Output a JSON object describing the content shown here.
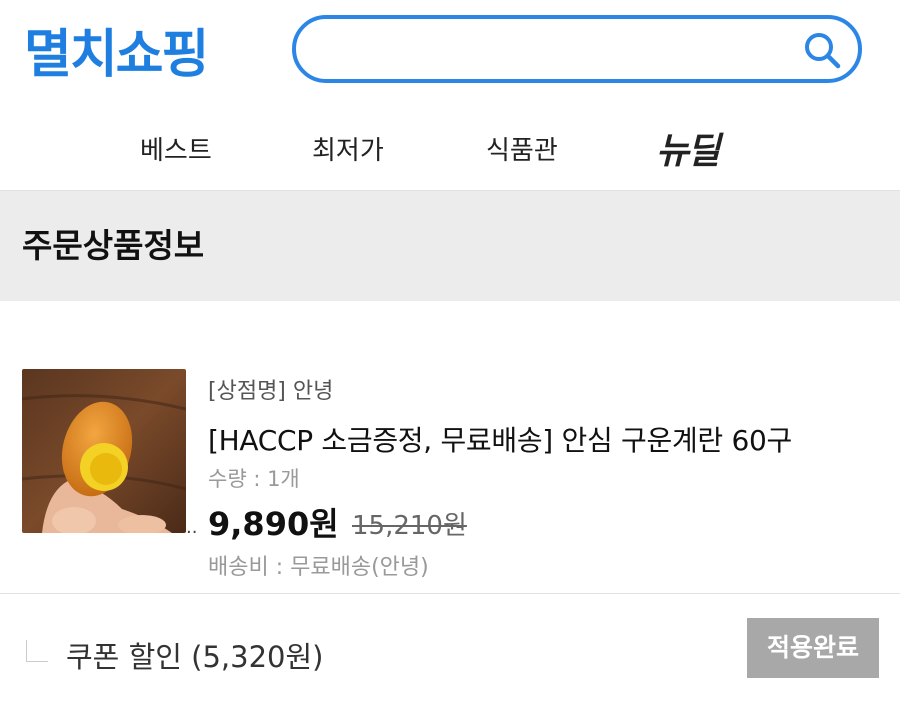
{
  "header": {
    "logo_text": "멸치쇼핑",
    "search_placeholder": "",
    "search_value": ""
  },
  "nav": {
    "items": [
      "베스트",
      "최저가",
      "식품관",
      "뉴딜"
    ]
  },
  "section": {
    "title": "주문상품정보"
  },
  "product": {
    "store": "[상점명] 안녕",
    "name": "[HACCP 소금증정, 무료배송] 안심 구운계란 60구",
    "quantity": "수량 : 1개",
    "price": "9,890원",
    "original_price": "15,210원",
    "shipping": "배송비 : 무료배송(안녕)",
    "ellipsis": "..",
    "image_icon": "egg-product-photo"
  },
  "coupon": {
    "label": "쿠폰 할인 (5,320원)",
    "button_label": "적용완료"
  },
  "colors": {
    "brand_blue": "#1f7fe0",
    "section_bg": "#ececec",
    "button_gray": "#a8a8a8"
  }
}
